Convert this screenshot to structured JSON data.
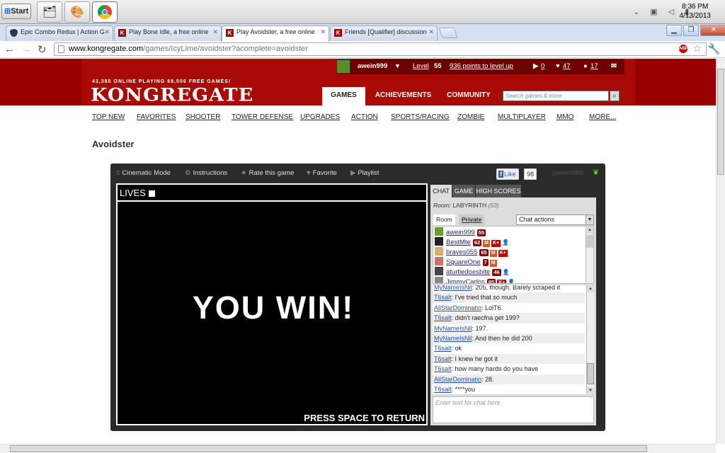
{
  "taskbar": {
    "start_label": "Start",
    "time": "8:36 PM",
    "date": "4/13/2013"
  },
  "tabs": [
    {
      "title": "Epic Combo Redux | Action G",
      "icon": "shield-icon"
    },
    {
      "title": "Play Bone Idle, a free online",
      "icon": "kongregate-icon"
    },
    {
      "title": "Play Avoidster, a free online",
      "icon": "kongregate-icon"
    },
    {
      "title": "Friends [Qualifier] discussion",
      "icon": "kongregate-icon"
    }
  ],
  "address": {
    "host": "www.kongregate.com",
    "path": "/games/IcyLime/avoidster?acomplete=avoidster"
  },
  "userbar": {
    "username": "awein999",
    "level_label": "Level",
    "level": "55",
    "points_to_level": "936 points to level up",
    "plays": "0",
    "likes": "47",
    "friends": "17"
  },
  "header": {
    "online_count": "43,388",
    "online_label": "ONLINE PLAYING",
    "games_count": "69,506",
    "games_label": "FREE GAMES!",
    "logo": "KONGREGATE",
    "nav": [
      "GAMES",
      "ACHIEVEMENTS",
      "COMMUNITY"
    ],
    "search_placeholder": "Search games & more"
  },
  "categories": [
    "TOP NEW",
    "FAVORITES",
    "SHOOTER",
    "TOWER DEFENSE",
    "UPGRADES",
    "ACTION",
    "SPORTS/RACING",
    "ZOMBIE",
    "MULTIPLAYER",
    "MMO",
    "MORE..."
  ],
  "page_title": "Avoidster",
  "game_toolbar": {
    "cinematic": "Cinematic Mode",
    "instructions": "Instructions",
    "rate": "Rate this game",
    "favorite": "Favorite",
    "playlist": "Playlist",
    "like_label": "Like",
    "like_count": "98",
    "user": "(awein999)"
  },
  "game": {
    "lives_label": "LIVES",
    "win_text": "YOU WIN!",
    "return_text": "PRESS SPACE TO RETURN"
  },
  "chat": {
    "tabs": [
      "CHAT",
      "GAME",
      "HIGH SCORES"
    ],
    "room_label": "Room:",
    "room_name": "LABYRINTH",
    "room_count": "(53)",
    "room_tab": "Room",
    "private_tab": "Private",
    "actions_label": "Chat actions",
    "users": [
      {
        "name": "awein999",
        "level": "55",
        "m": false,
        "k": false,
        "friend": false
      },
      {
        "name": "BestMte",
        "level": "62",
        "m": true,
        "k": true,
        "friend": true
      },
      {
        "name": "braves055",
        "level": "65",
        "m": true,
        "k": true,
        "friend": false
      },
      {
        "name": "SquareOne",
        "level": "7",
        "m": true,
        "k": false,
        "friend": false
      },
      {
        "name": "aturtledoesbite",
        "level": "46",
        "m": false,
        "k": false,
        "friend": true
      },
      {
        "name": "JimmyCarlos",
        "level": "65",
        "m": false,
        "k": true,
        "friend": true
      }
    ],
    "messages": [
      {
        "who": "MyNameIsNil",
        "text": ": 205, though. Barely scraped it"
      },
      {
        "who": "T6salt",
        "text": ": I've tried that so much"
      },
      {
        "who": "AllStarDominatio",
        "text": ": LolT6."
      },
      {
        "who": "T6salt",
        "text": ": didn't raecfna get 199?"
      },
      {
        "who": "MyNameIsNil",
        "text": ": 197."
      },
      {
        "who": "MyNameIsNil",
        "text": ": And then he did 200"
      },
      {
        "who": "T6salt",
        "text": ": ok"
      },
      {
        "who": "T6salt",
        "text": ": I knew he got it"
      },
      {
        "who": "T6salt",
        "text": ": how many hards do you have"
      },
      {
        "who": "AllStarDominatio",
        "text": ": 28."
      },
      {
        "who": "T6salt",
        "text": ": ****you"
      }
    ],
    "input_placeholder": "Enter text for chat here"
  }
}
